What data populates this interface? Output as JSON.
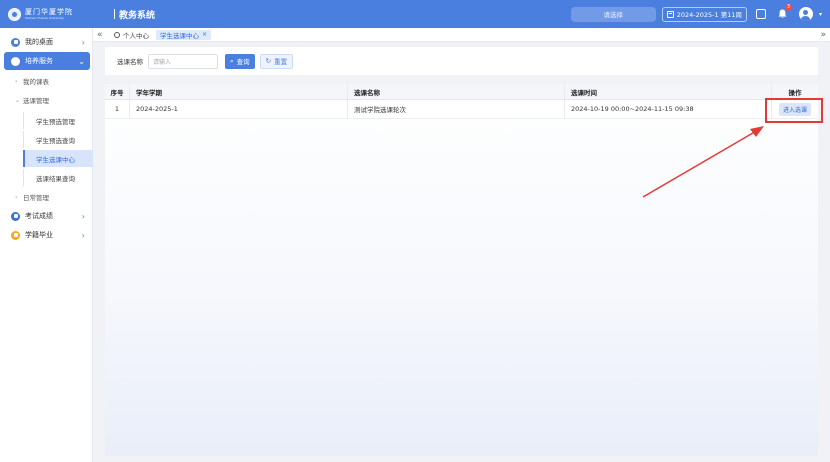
{
  "header": {
    "logo_text": "厦门华厦学院",
    "logo_subtext": "Xiamen Huaxia University",
    "system_name": "教务系统",
    "search_placeholder": "请选择",
    "term": "2024-2025-1 第11周",
    "notification_count": "3",
    "brand_color": "#4a7fe0"
  },
  "sidebar": {
    "items": [
      {
        "label": "我的桌面",
        "icon": "desktop-icon",
        "color": "#4a7fe0"
      },
      {
        "label": "培养服务",
        "icon": "training-icon",
        "color": "#ffffff"
      },
      {
        "label": "考试成绩",
        "icon": "exam-icon",
        "color": "#3a6fd8"
      },
      {
        "label": "学籍毕业",
        "icon": "graduation-icon",
        "color": "#f5a623"
      }
    ],
    "sub_items": [
      {
        "label": "我的课表"
      },
      {
        "label": "选课管理"
      },
      {
        "label": "日常管理"
      }
    ],
    "leaves": [
      {
        "label": "学生预选管理"
      },
      {
        "label": "学生预选查询"
      },
      {
        "label": "学生选课中心"
      },
      {
        "label": "选课结果查询"
      }
    ]
  },
  "tabs": {
    "home_label": "个人中心",
    "active_label": "学生选课中心"
  },
  "search": {
    "label": "选课名称",
    "placeholder": "请输入",
    "query_button": "查询",
    "reset_button": "重置"
  },
  "table": {
    "columns": [
      "序号",
      "学年学期",
      "选课名称",
      "选课时间",
      "操作"
    ],
    "rows": [
      {
        "index": "1",
        "term": "2024-2025-1",
        "name": "测试学院选课轮次",
        "time": "2024-10-19 00:00~2024-11-15 09:38",
        "action": "进入选课"
      }
    ]
  },
  "annotation_color": "#e53935"
}
